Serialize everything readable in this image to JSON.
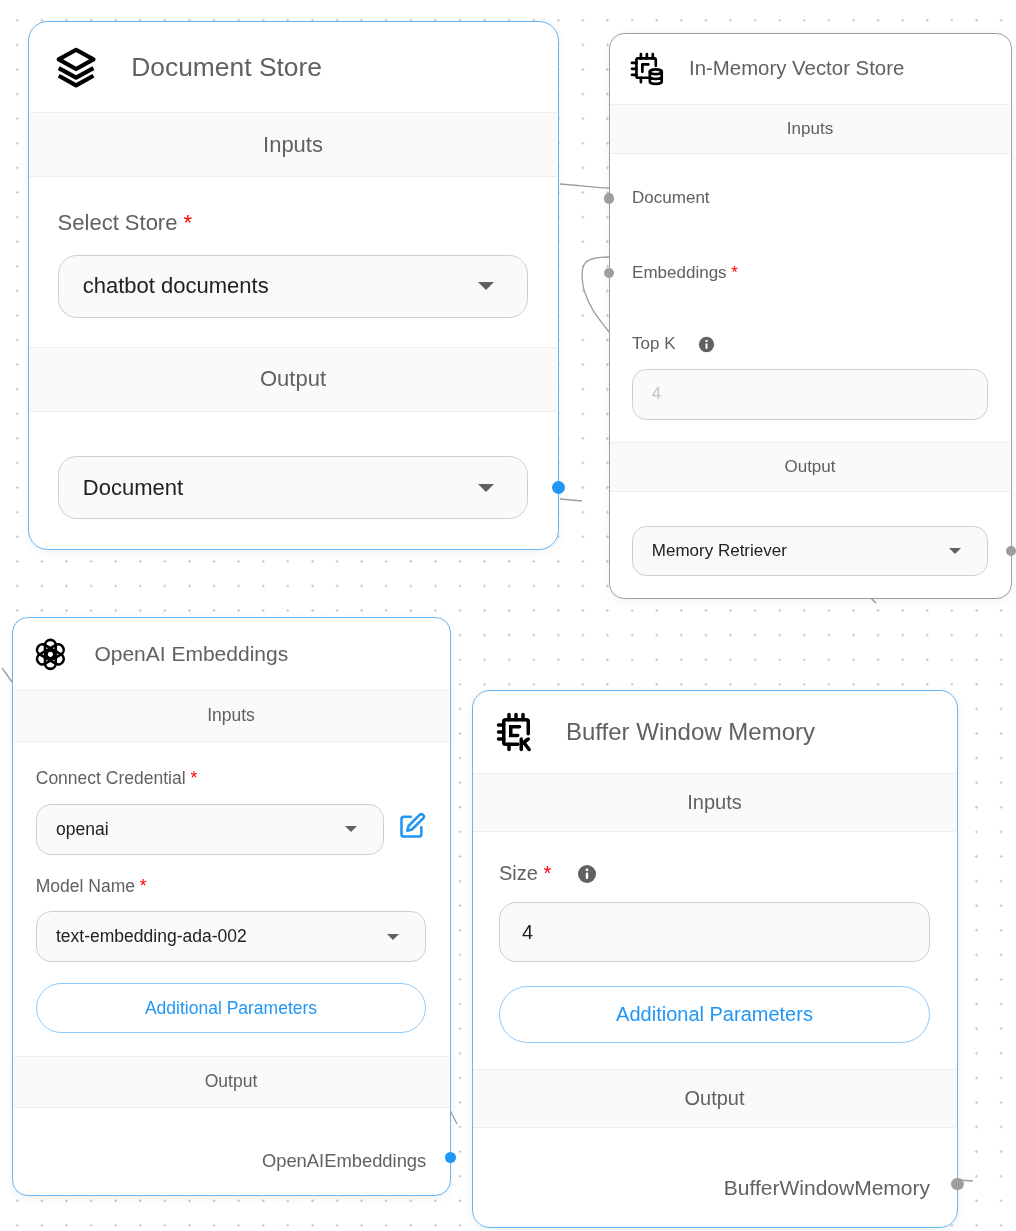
{
  "nodes": [
    {
      "title": "Document Store",
      "selected": true,
      "inputs_heading": "Inputs",
      "output_heading": "Output",
      "inputs": [
        {
          "kind": "select",
          "label": "Select Store",
          "mark": "*",
          "value": "chatbot documents"
        }
      ],
      "output": {
        "kind": "select",
        "value": "Document",
        "active": true
      }
    },
    {
      "title": "In-Memory Vector Store",
      "selected": false,
      "inputs_heading": "Inputs",
      "output_heading": "Output",
      "inputs": [
        {
          "kind": "anchor",
          "label": "Document",
          "active": false
        },
        {
          "kind": "anchor",
          "label": "Embeddings",
          "mark": "*",
          "active": false
        },
        {
          "kind": "number",
          "label": "Top K",
          "info": true,
          "placeholder": "4"
        }
      ],
      "output": {
        "kind": "select",
        "value": "Memory Retriever",
        "active": false
      }
    },
    {
      "title": "OpenAI Embeddings",
      "selected": true,
      "inputs_heading": "Inputs",
      "output_heading": "Output",
      "inputs": [
        {
          "kind": "select",
          "label": "Connect Credential",
          "mark": "*",
          "value": "openai",
          "editable": true
        },
        {
          "kind": "select",
          "label": "Model Name",
          "mark": "*",
          "value": "text-embedding-ada-002"
        },
        {
          "kind": "button",
          "label": "Additional Parameters"
        }
      ],
      "output": {
        "kind": "anchor",
        "value": "OpenAIEmbeddings",
        "active": true
      }
    },
    {
      "title": "Buffer Window Memory",
      "selected": true,
      "inputs_heading": "Inputs",
      "output_heading": "Output",
      "inputs": [
        {
          "kind": "number",
          "label": "Size",
          "mark": "*",
          "info": true,
          "value": "4"
        },
        {
          "kind": "button",
          "label": "Additional Parameters"
        }
      ],
      "output": {
        "kind": "anchor",
        "value": "BufferWindowMemory",
        "active": false
      }
    }
  ]
}
